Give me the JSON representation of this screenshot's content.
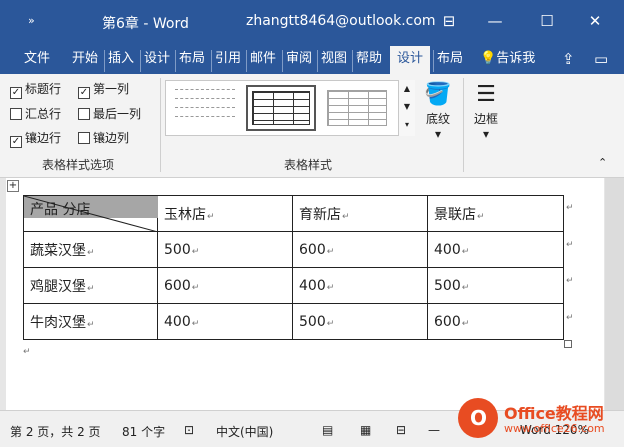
{
  "titlebar": {
    "quick_access": "»",
    "doc_title": "第6章 - Word",
    "account": "zhangtt8464@outlook.com",
    "controls": {
      "ribbon_display": "⊟",
      "minimize": "—",
      "maximize": "☐",
      "close": "✕"
    }
  },
  "tabs": [
    "文件",
    "开始",
    "插入",
    "设计",
    "布局",
    "引用",
    "邮件",
    "审阅",
    "视图",
    "帮助",
    "设计",
    "布局"
  ],
  "tab_tell_me": "告诉我",
  "ribbon": {
    "options": [
      {
        "label": "标题行",
        "checked": true
      },
      {
        "label": "第一列",
        "checked": true
      },
      {
        "label": "汇总行",
        "checked": false
      },
      {
        "label": "最后一列",
        "checked": false
      },
      {
        "label": "镶边行",
        "checked": true
      },
      {
        "label": "镶边列",
        "checked": false
      }
    ],
    "group_options_label": "表格样式选项",
    "group_styles_label": "表格样式",
    "shading_label": "底纹",
    "borders_label": "边框",
    "dropdown_arrow": "▾"
  },
  "table": {
    "header": [
      "产品 分店",
      "玉林店",
      "育新店",
      "景联店"
    ],
    "rows": [
      [
        "蔬菜汉堡",
        "500",
        "600",
        "400"
      ],
      [
        "鸡腿汉堡",
        "600",
        "400",
        "500"
      ],
      [
        "牛肉汉堡",
        "400",
        "500",
        "600"
      ]
    ]
  },
  "status": {
    "page": "第 2 页，共 2 页",
    "words": "81 个字",
    "language": "中文(中国)",
    "zoom": "Word 120%"
  },
  "watermark": {
    "brand": "Office教程网",
    "url": "www.office26.com"
  },
  "colors": {
    "title_bar": "#2b579a",
    "header_fill": "#a6a6a6",
    "logo": "#e84c22"
  }
}
